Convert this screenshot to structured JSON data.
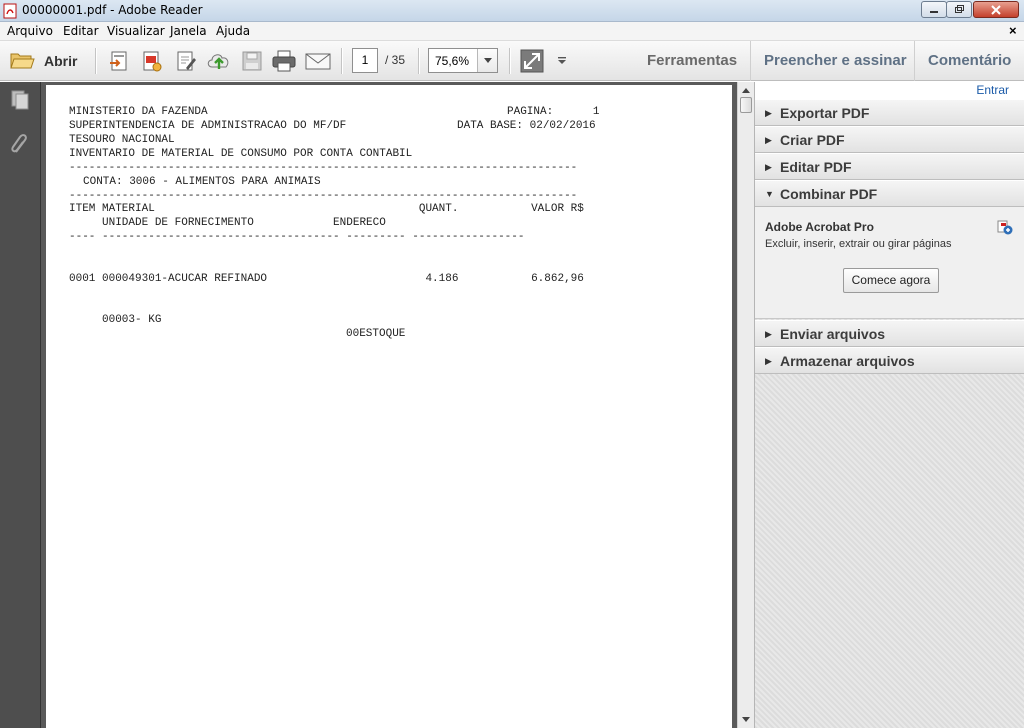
{
  "window": {
    "title": "00000001.pdf - Adobe Reader"
  },
  "menu": {
    "items": [
      "Arquivo",
      "Editar",
      "Visualizar",
      "Janela",
      "Ajuda"
    ],
    "close_glyph": "×"
  },
  "toolbar": {
    "open_label": "Abrir",
    "page_current": "1",
    "page_total": "/ 35",
    "zoom": "75,6%",
    "tabs": {
      "tools": "Ferramentas",
      "fill_sign": "Preencher e assinar",
      "comment": "Comentário"
    },
    "icons": [
      "open-folder-icon",
      "export-pdf-icon",
      "create-pdf-icon",
      "edit-pdf-icon",
      "upload-cloud-icon",
      "save-icon",
      "print-icon",
      "email-icon",
      "fullscreen-icon",
      "customize-toolbar-icon"
    ]
  },
  "leftnav": {
    "icons": [
      "pages-panel-icon",
      "attachments-icon"
    ]
  },
  "document": {
    "header_left": [
      "MINISTERIO DA FAZENDA",
      "SUPERINTENDENCIA DE ADMINISTRACAO DO MF/DF",
      "TESOURO NACIONAL",
      "INVENTARIO DE MATERIAL DE CONSUMO POR CONTA CONTABIL"
    ],
    "page_label": "PAGINA:      1",
    "base_date": "DATA BASE: 02/02/2016",
    "rule": "-----------------------------------------------------------------------------",
    "account": "CONTA: 3006 - ALIMENTOS PARA ANIMAIS",
    "col_line1": "ITEM MATERIAL                                        QUANT.           VALOR R$",
    "col_line2": "     UNIDADE DE FORNECIMENTO            ENDERECO",
    "col_rule": "---- ------------------------------------ --------- -----------------",
    "row_item": "0001 000049301-ACUCAR REFINADO                        4.186           6.862,96",
    "row_unit": "     00003- KG",
    "row_address": "00ESTOQUE"
  },
  "rightpane": {
    "signin": "Entrar",
    "panels": [
      {
        "label": "Exportar PDF",
        "expanded": false
      },
      {
        "label": "Criar PDF",
        "expanded": false
      },
      {
        "label": "Editar PDF",
        "expanded": false
      },
      {
        "label": "Combinar PDF",
        "expanded": true
      },
      {
        "label": "Enviar arquivos",
        "expanded": false
      },
      {
        "label": "Armazenar arquivos",
        "expanded": false
      }
    ],
    "combine": {
      "product": "Adobe Acrobat Pro",
      "description": "Excluir, inserir, extrair ou girar páginas",
      "button": "Comece agora"
    },
    "collapsed_glyph": "▶",
    "expanded_glyph": "▼"
  }
}
